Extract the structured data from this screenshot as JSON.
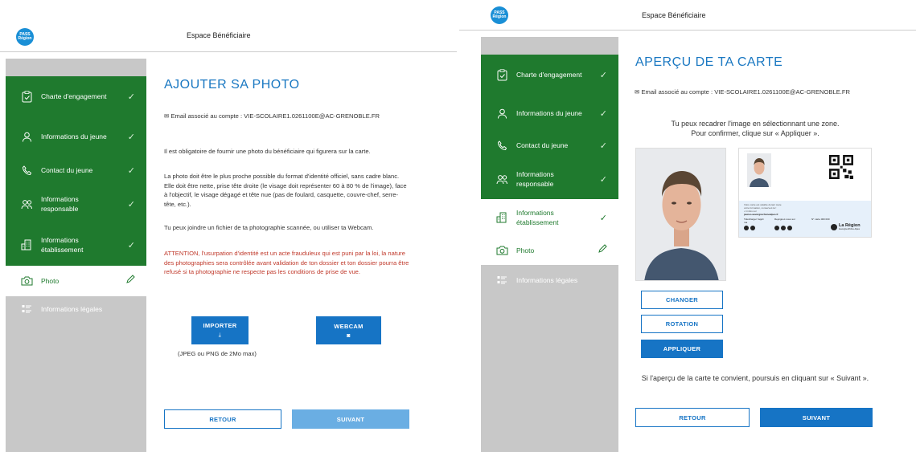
{
  "header": {
    "site_title": "Espace Bénéficiaire",
    "logo_line1": "PASS",
    "logo_line2": "Région"
  },
  "sidebar": {
    "items": [
      {
        "label": "Charte d'engagement",
        "icon": "clipboard-icon",
        "status": "done"
      },
      {
        "label": "Informations du jeune",
        "icon": "user-icon",
        "status": "done"
      },
      {
        "label": "Contact du jeune",
        "icon": "phone-icon",
        "status": "done"
      },
      {
        "label": "Informations responsable",
        "icon": "users-icon",
        "status": "done"
      },
      {
        "label": "Informations établissement",
        "icon": "building-icon",
        "status": "done"
      },
      {
        "label": "Photo",
        "icon": "camera-icon",
        "status": "current"
      },
      {
        "label": "Informations légales",
        "icon": "list-icon",
        "status": "todo"
      }
    ]
  },
  "left_page": {
    "title": "AJOUTER SA PHOTO",
    "email": "✉ Email associé au compte : VIE-SCOLAIRE1.0261100E@AC-GRENOBLE.FR",
    "p1": "Il est obligatoire de fournir une photo du bénéficiaire qui figurera sur la carte.",
    "p2": "La photo doit être le plus proche possible du format d'identité officiel, sans cadre blanc. Elle doit être nette, prise tête droite (le visage doit représenter 60 à 80 % de l'image), face à l'objectif, le visage dégagé et tête nue (pas de foulard, casquette, couvre-chef, serre-tête, etc.).",
    "p3": "Tu peux joindre un fichier de ta photographie scannée, ou utiliser ta Webcam.",
    "warning": "ATTENTION, l'usurpation d'identité est un acte frauduleux qui est puni par la loi, la nature des photographies sera contrôlée avant validation de ton dossier et ton dossier pourra être refusé si ta photographie ne respecte pas les conditions de prise de vue.",
    "import_label": "IMPORTER",
    "webcam_label": "WEBCAM",
    "format_hint": "(JPEG ou PNG de 2Mo max)",
    "back_label": "RETOUR",
    "next_label": "SUIVANT"
  },
  "right_page": {
    "title": "APERÇU DE TA CARTE",
    "email": "✉ Email associé au compte : VIE-SCOLAIRE1.0261100E@AC-GRENOBLE.FR",
    "crop_hint_1": "Tu peux recadrer l'image en sélectionnant une zone.",
    "crop_hint_2": "Pour confirmer, clique sur « Appliquer ».",
    "change_label": "CHANGER",
    "rotate_label": "ROTATION",
    "apply_label": "APPLIQUER",
    "continue_hint": "Si l'aperçu de la carte te convient, poursuis en cliquant sur « Suivant ».",
    "back_label": "RETOUR",
    "next_label": "SUIVANT",
    "card": {
      "note_line1": "Votre carte est valable durant toute",
      "note_line2": "votre formation, conservez-la !",
      "note_line3": "• 4 infos sur",
      "site": "jeunes.auvergnerhonealpes.fr",
      "download_label": "Télécharger l'appli ma",
      "join_label": "Rejoignez-nous sur",
      "card_number_label": "N° carte 000 000",
      "region_name": "La Région",
      "region_sub": "Auvergne-Rhône-Alpes"
    }
  },
  "colors": {
    "green": "#1f7a2e",
    "blue": "#1674c5",
    "grey": "#c8c8c8",
    "red": "#c0392b"
  }
}
